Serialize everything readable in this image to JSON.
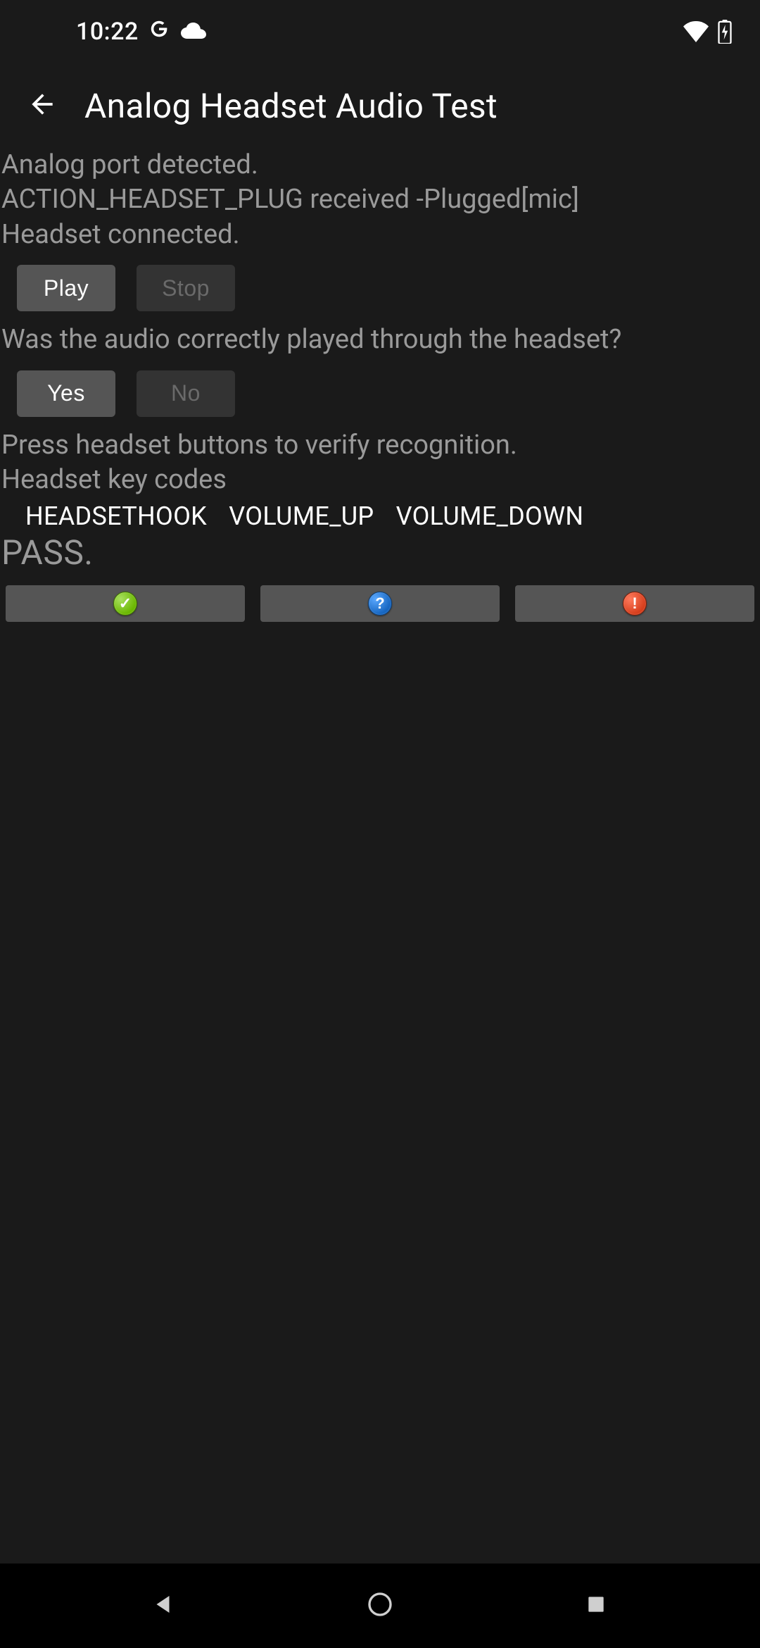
{
  "status_bar": {
    "time": "10:22"
  },
  "header": {
    "title": "Analog Headset Audio Test"
  },
  "main": {
    "detect_line1": "Analog port detected.",
    "detect_line2": "ACTION_HEADSET_PLUG received -Plugged[mic]",
    "detect_line3": "Headset connected.",
    "play_label": "Play",
    "stop_label": "Stop",
    "question": "Was the audio correctly played through the headset?",
    "yes_label": "Yes",
    "no_label": "No",
    "instruction_line1": "Press headset buttons to verify recognition.",
    "instruction_line2": "Headset key codes",
    "keycodes": "HEADSETHOOK    VOLUME_UP    VOLUME_DOWN",
    "result": "PASS.",
    "result_buttons": {
      "pass_symbol": "✓",
      "info_symbol": "?",
      "fail_symbol": "!"
    }
  }
}
